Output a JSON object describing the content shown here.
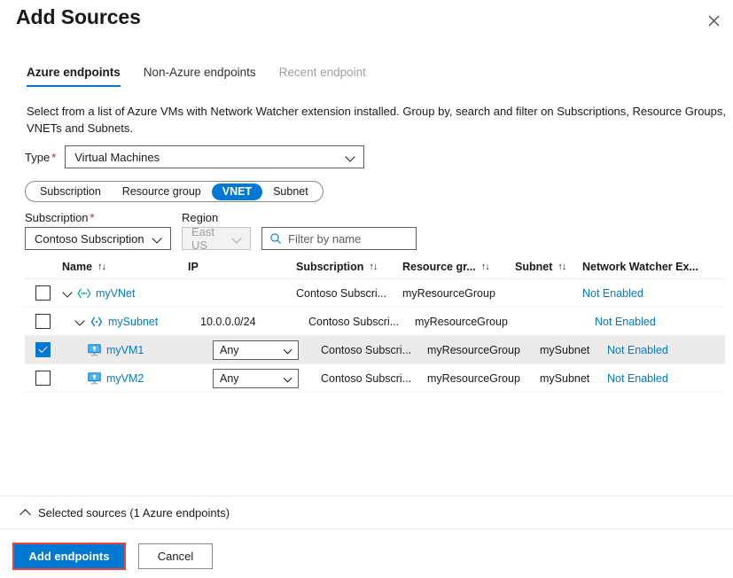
{
  "panel": {
    "title": "Add Sources",
    "close_icon": "close-icon"
  },
  "tabs": [
    {
      "label": "Azure endpoints",
      "state": "active"
    },
    {
      "label": "Non-Azure endpoints",
      "state": "normal"
    },
    {
      "label": "Recent endpoint",
      "state": "disabled"
    }
  ],
  "description": "Select from a list of Azure VMs with Network Watcher extension installed. Group by, search and filter on Subscriptions, Resource Groups, VNETs and Subnets.",
  "type_field": {
    "label": "Type",
    "required_marker": "*",
    "value": "Virtual Machines"
  },
  "group_by_pills": [
    {
      "label": "Subscription",
      "selected": false
    },
    {
      "label": "Resource group",
      "selected": false
    },
    {
      "label": "VNET",
      "selected": true
    },
    {
      "label": "Subnet",
      "selected": false
    }
  ],
  "filters": {
    "subscription": {
      "label": "Subscription",
      "required_marker": "*",
      "value": "Contoso Subscription"
    },
    "region": {
      "label": "Region",
      "value": "East US",
      "disabled": true
    },
    "search": {
      "placeholder": "Filter by name",
      "value": "",
      "icon": "search-icon"
    }
  },
  "table": {
    "columns": [
      {
        "key": "name",
        "label": "Name",
        "sortable": true
      },
      {
        "key": "ip",
        "label": "IP",
        "sortable": false
      },
      {
        "key": "subscription",
        "label": "Subscription",
        "sortable": true
      },
      {
        "key": "resource_group",
        "label": "Resource gr...",
        "sortable": true
      },
      {
        "key": "subnet",
        "label": "Subnet",
        "sortable": true
      },
      {
        "key": "network_watcher",
        "label": "Network Watcher Ex...",
        "sortable": false
      }
    ],
    "sort_glyph": "↑↓",
    "rows": [
      {
        "checked": false,
        "selected": false,
        "indent": 0,
        "expandable": true,
        "icon": "vnet-icon",
        "name": "myVNet",
        "ip": "",
        "has_ip_dropdown": false,
        "subscription": "Contoso Subscri...",
        "resource_group": "myResourceGroup",
        "subnet": "",
        "network_watcher": "Not Enabled"
      },
      {
        "checked": false,
        "selected": false,
        "indent": 1,
        "expandable": true,
        "icon": "subnet-icon",
        "name": "mySubnet",
        "ip": "10.0.0.0/24",
        "has_ip_dropdown": false,
        "subscription": "Contoso Subscri...",
        "resource_group": "myResourceGroup",
        "subnet": "",
        "network_watcher": "Not Enabled"
      },
      {
        "checked": true,
        "selected": true,
        "indent": 2,
        "expandable": false,
        "icon": "virtual-machine-icon",
        "name": "myVM1",
        "ip": "Any",
        "has_ip_dropdown": true,
        "subscription": "Contoso Subscri...",
        "resource_group": "myResourceGroup",
        "subnet": "mySubnet",
        "network_watcher": "Not Enabled"
      },
      {
        "checked": false,
        "selected": false,
        "indent": 2,
        "expandable": false,
        "icon": "virtual-machine-icon",
        "name": "myVM2",
        "ip": "Any",
        "has_ip_dropdown": true,
        "subscription": "Contoso Subscri...",
        "resource_group": "myResourceGroup",
        "subnet": "mySubnet",
        "network_watcher": "Not Enabled"
      }
    ]
  },
  "selected_sources_bar": {
    "label": "Selected sources (1 Azure endpoints)",
    "expanded": true
  },
  "actions": {
    "primary_label": "Add endpoints",
    "secondary_label": "Cancel",
    "primary_highlighted": true
  },
  "colors": {
    "accent": "#0078d4",
    "highlight_outline": "#f0423c",
    "link": "#0078d4",
    "required": "#a4262c",
    "row_selected_bg": "#edebe9",
    "vnet_icon": "#00b294",
    "subnet_icon": "#0078d4"
  }
}
